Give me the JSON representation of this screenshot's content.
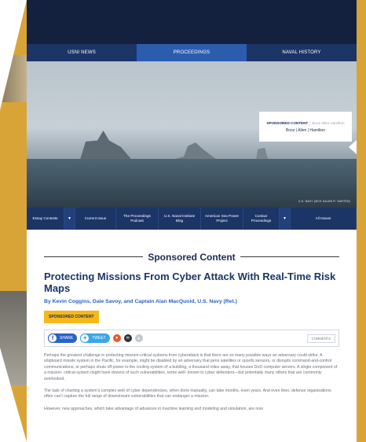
{
  "top_nav": {
    "items": [
      "USNI NEWS",
      "PROCEEDINGS",
      "NAVAL HISTORY"
    ],
    "active_index": 1
  },
  "hero": {
    "sponsor_label": "SPONSORED CONTENT",
    "sponsor_name": "Booz Allen Hamilton",
    "sponsor_logo_text": "Booz | Allen | Hamilton",
    "photo_credit": "U.S. NAVY (MCS KALEB R. SARTEN)"
  },
  "sub_nav": {
    "items": [
      {
        "label": "Essay Contests"
      },
      {
        "label": "Current Issue"
      },
      {
        "label": "The Proceedings Podcast"
      },
      {
        "label": "U.S. Naval Institute Blog"
      },
      {
        "label": "American Sea Power Project"
      },
      {
        "label": "Contact Proceedings"
      },
      {
        "label": "All Issues"
      }
    ],
    "caret": "▼"
  },
  "article": {
    "section_heading": "Sponsored Content",
    "title": "Protecting Missions From Cyber Attack With Real-Time Risk Maps",
    "byline": "By Kevin Coggins, Dale Savoy, and Captain Alan MacQuoid, U.S. Navy (Ret.)",
    "badge": "SPONSORED CONTENT",
    "share": {
      "facebook_label": "SHARE",
      "twitter_label": "TWEET",
      "comments_label": "COMMENTS"
    },
    "paragraphs": [
      "Perhaps the greatest challenge in protecting mission-critical systems from cyberattack is that there are so many possible ways an adversary could strike. A shipboard missile system in the Pacific, for example, might be disabled by an adversary that jams satellites or spoofs sensors, or disrupts command-and-control communications, or perhaps shuts off power to the cooling system of a building, a thousand miles away, that houses DoD computer servers. A single component of a mission- critical system might have dozens of such vulnerabilities, some well- known to cyber defenders—but potentially many others that are commonly overlooked.",
      "The task of charting a system's complex web of cyber dependencies, when done manually, can take months, even years. And even then, defense organizations often can't capture the full range of downstream vulnerabilities that can endanger a mission.",
      "However, new approaches, which take advantage of advances in machine learning and modeling and simulation, are now"
    ]
  },
  "colors": {
    "navy": "#13213f",
    "nav_blue": "#1c3567",
    "active_blue": "#2b5cae",
    "gold": "#d9a437",
    "badge_yellow": "#f6b81b",
    "link_blue": "#2a62c9"
  }
}
